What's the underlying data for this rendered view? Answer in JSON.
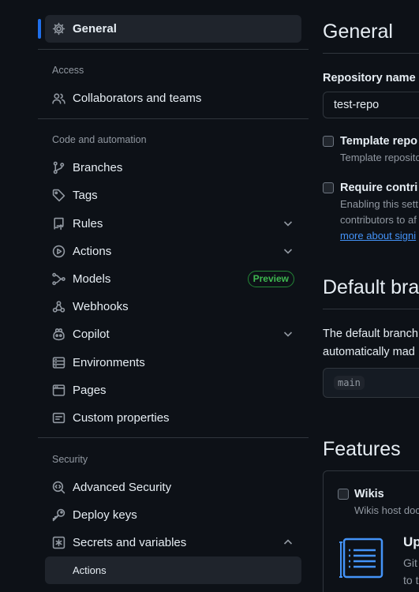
{
  "sidebar": {
    "general": "General",
    "sections": {
      "access": "Access",
      "code_automation": "Code and automation",
      "security": "Security"
    },
    "items": {
      "collaborators": "Collaborators and teams",
      "branches": "Branches",
      "tags": "Tags",
      "rules": "Rules",
      "actions": "Actions",
      "models": "Models",
      "models_badge": "Preview",
      "webhooks": "Webhooks",
      "copilot": "Copilot",
      "environments": "Environments",
      "pages": "Pages",
      "custom_properties": "Custom properties",
      "advanced_security": "Advanced Security",
      "deploy_keys": "Deploy keys",
      "secrets_variables": "Secrets and variables",
      "secrets_actions": "Actions"
    }
  },
  "main": {
    "title": "General",
    "repo_name_label": "Repository name",
    "repo_name_value": "test-repo",
    "template_title": "Template repo",
    "template_desc": "Template reposito",
    "require_title": "Require contri",
    "require_desc_1": "Enabling this sett",
    "require_desc_2": "contributors to af",
    "require_link": "more about signi",
    "default_branch_title": "Default bra",
    "default_branch_text_1": "The default branch",
    "default_branch_text_2": "automatically mad",
    "default_branch_value": "main",
    "features_title": "Features",
    "wikis_title": "Wikis",
    "wikis_desc": "Wikis host doc",
    "upgrade_title": "Up",
    "upgrade_text_1": "Git",
    "upgrade_text_2": "to t"
  },
  "colors": {
    "accent": "#1f6feb",
    "link": "#4493f8",
    "badge_green": "#3fb950",
    "background": "#0d1117"
  }
}
